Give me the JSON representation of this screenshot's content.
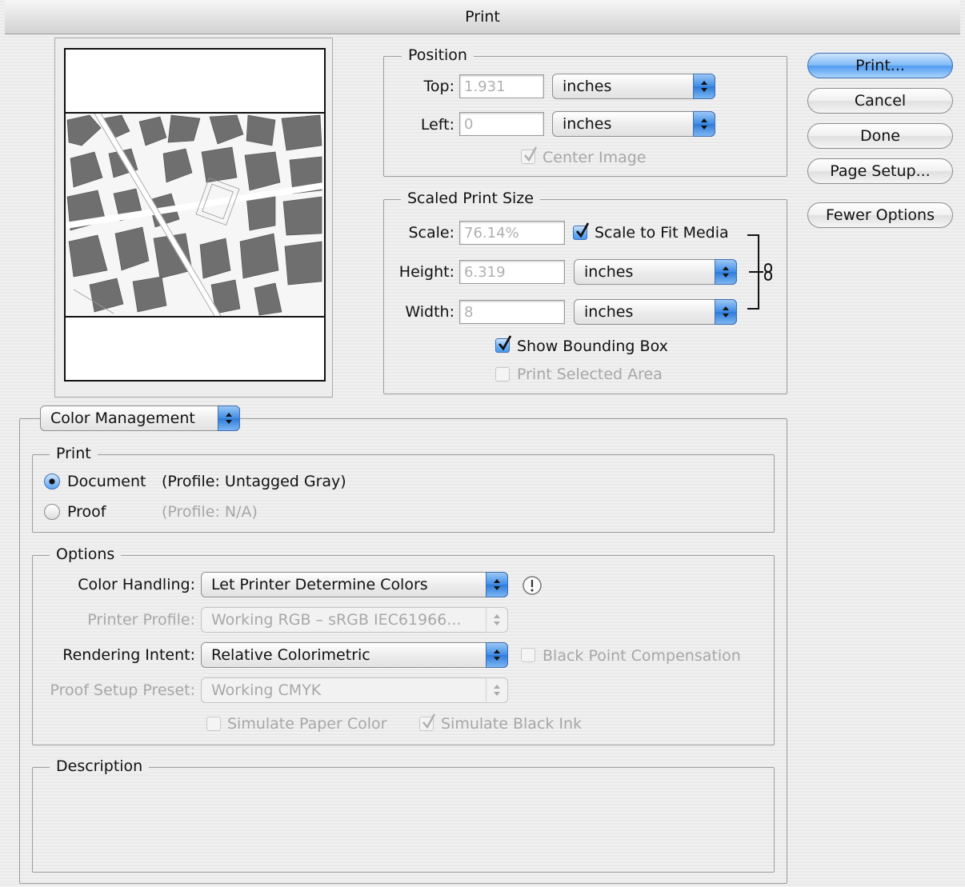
{
  "window": {
    "title": "Print"
  },
  "buttons": {
    "print": "Print...",
    "cancel": "Cancel",
    "done": "Done",
    "page_setup": "Page Setup...",
    "fewer_options": "Fewer Options"
  },
  "position": {
    "legend": "Position",
    "top_label": "Top:",
    "top_value": "1.931",
    "top_unit": "inches",
    "left_label": "Left:",
    "left_value": "0",
    "left_unit": "inches",
    "center_image": "Center Image",
    "center_image_checked": true
  },
  "scaled": {
    "legend": "Scaled Print Size",
    "scale_label": "Scale:",
    "scale_value": "76.14%",
    "scale_to_fit": "Scale to Fit Media",
    "scale_to_fit_checked": true,
    "height_label": "Height:",
    "height_value": "6.319",
    "height_unit": "inches",
    "width_label": "Width:",
    "width_value": "8",
    "width_unit": "inches",
    "show_bounding_box": "Show Bounding Box",
    "show_bounding_box_checked": true,
    "print_selected_area": "Print Selected Area",
    "print_selected_area_checked": false
  },
  "color_mgmt": {
    "menu": "Color Management",
    "print_legend": "Print",
    "document": "Document",
    "document_profile": "(Profile: Untagged Gray)",
    "proof": "Proof",
    "proof_profile": "(Profile: N/A)",
    "selected": "Document"
  },
  "options": {
    "legend": "Options",
    "color_handling_label": "Color Handling:",
    "color_handling_value": "Let Printer Determine Colors",
    "printer_profile_label": "Printer Profile:",
    "printer_profile_value": "Working RGB – sRGB IEC61966...",
    "rendering_intent_label": "Rendering Intent:",
    "rendering_intent_value": "Relative Colorimetric",
    "black_point": "Black Point Compensation",
    "proof_setup_label": "Proof Setup Preset:",
    "proof_setup_value": "Working CMYK",
    "simulate_paper": "Simulate Paper Color",
    "simulate_black": "Simulate Black Ink",
    "warning_icon": "exclamation-icon"
  },
  "description": {
    "legend": "Description"
  },
  "colors": {
    "accent": "#4e9af0",
    "building": "#6f6f6f"
  }
}
